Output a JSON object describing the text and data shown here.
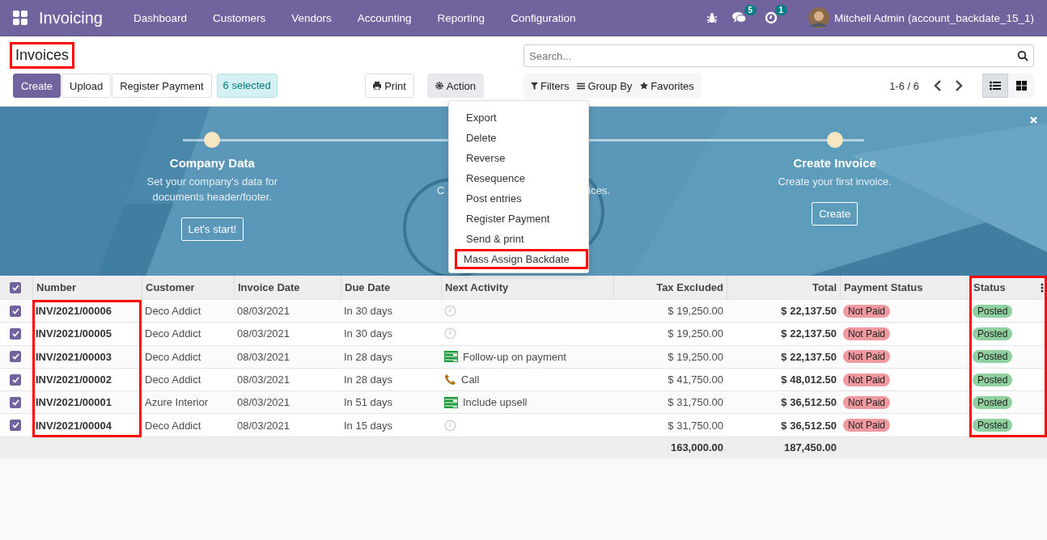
{
  "navbar": {
    "app_name": "Invoicing",
    "menu": [
      "Dashboard",
      "Customers",
      "Vendors",
      "Accounting",
      "Reporting",
      "Configuration"
    ],
    "messages_badge": "5",
    "activities_badge": "1",
    "user": "Mitchell Admin (account_backdate_15_1)"
  },
  "control_panel": {
    "title": "Invoices",
    "title_highlighted": true,
    "buttons": [
      {
        "label": "Create",
        "kind": "primary"
      },
      {
        "label": "Upload",
        "kind": "secondary"
      },
      {
        "label": "Register Payment",
        "kind": "secondary"
      }
    ],
    "selection": "6 selected",
    "print": "Print",
    "action": "Action",
    "search": {
      "placeholder": "Search..."
    },
    "filters": "Filters",
    "group_by": "Group By",
    "favorites": "Favorites",
    "pager": "1-6 / 6",
    "views": [
      {
        "kind": "list",
        "selected": true
      },
      {
        "kind": "kanban",
        "selected": false
      }
    ]
  },
  "action_menu": {
    "items": [
      {
        "label": "Export",
        "highlighted": false
      },
      {
        "label": "Delete",
        "highlighted": false
      },
      {
        "label": "Reverse",
        "highlighted": false
      },
      {
        "label": "Resequence",
        "highlighted": false
      },
      {
        "label": "Post entries",
        "highlighted": false
      },
      {
        "label": "Register Payment",
        "highlighted": false
      },
      {
        "label": "Send & print",
        "highlighted": false
      },
      {
        "label": "Mass Assign Backdate",
        "highlighted": true
      }
    ]
  },
  "banner": {
    "steps": [
      {
        "title": "Company Data",
        "description": "Set your company's data for documents header/footer.",
        "button": "Let's start!"
      },
      {
        "fragment_left": "C",
        "fragment_right": "ices."
      },
      {
        "title": "Create Invoice",
        "description": "Create your first invoice.",
        "button": "Create"
      }
    ]
  },
  "table": {
    "all_selected": true,
    "columns": [
      {
        "label": "Number",
        "highlighted": true
      },
      {
        "label": "Customer",
        "highlighted": false
      },
      {
        "label": "Invoice Date",
        "highlighted": false
      },
      {
        "label": "Due Date",
        "highlighted": false
      },
      {
        "label": "Next Activity",
        "highlighted": false
      },
      {
        "label": "Tax Excluded",
        "highlighted": false
      },
      {
        "label": "Total",
        "highlighted": false
      },
      {
        "label": "Payment Status",
        "highlighted": false
      },
      {
        "label": "Status",
        "highlighted": true
      }
    ],
    "rows": [
      {
        "selected": true,
        "number": "INV/2021/00006",
        "customer": "Deco Addict",
        "invoice_date": "08/03/2021",
        "due_date": "In 30 days",
        "activity": {
          "kind": "none"
        },
        "tax_excluded": "$ 19,250.00",
        "total": "$ 22,137.50",
        "payment_status": "Not Paid",
        "status": "Posted"
      },
      {
        "selected": true,
        "number": "INV/2021/00005",
        "customer": "Deco Addict",
        "invoice_date": "08/03/2021",
        "due_date": "In 30 days",
        "activity": {
          "kind": "none"
        },
        "tax_excluded": "$ 19,250.00",
        "total": "$ 22,137.50",
        "payment_status": "Not Paid",
        "status": "Posted"
      },
      {
        "selected": true,
        "number": "INV/2021/00003",
        "customer": "Deco Addict",
        "invoice_date": "08/03/2021",
        "due_date": "In 28 days",
        "activity": {
          "kind": "todo",
          "text": "Follow-up on payment"
        },
        "tax_excluded": "$ 19,250.00",
        "total": "$ 22,137.50",
        "payment_status": "Not Paid",
        "status": "Posted"
      },
      {
        "selected": true,
        "number": "INV/2021/00002",
        "customer": "Deco Addict",
        "invoice_date": "08/03/2021",
        "due_date": "In 28 days",
        "activity": {
          "kind": "call",
          "text": "Call"
        },
        "tax_excluded": "$ 41,750.00",
        "total": "$ 48,012.50",
        "payment_status": "Not Paid",
        "status": "Posted"
      },
      {
        "selected": true,
        "number": "INV/2021/00001",
        "customer": "Azure Interior",
        "invoice_date": "08/03/2021",
        "due_date": "In 51 days",
        "activity": {
          "kind": "todo",
          "text": "Include upsell"
        },
        "tax_excluded": "$ 31,750.00",
        "total": "$ 36,512.50",
        "payment_status": "Not Paid",
        "status": "Posted"
      },
      {
        "selected": true,
        "number": "INV/2021/00004",
        "customer": "Deco Addict",
        "invoice_date": "08/03/2021",
        "due_date": "In 15 days",
        "activity": {
          "kind": "none"
        },
        "tax_excluded": "$ 31,750.00",
        "total": "$ 36,512.50",
        "payment_status": "Not Paid",
        "status": "Posted"
      }
    ],
    "totals": {
      "tax_excluded": "163,000.00",
      "total": "187,450.00"
    }
  }
}
